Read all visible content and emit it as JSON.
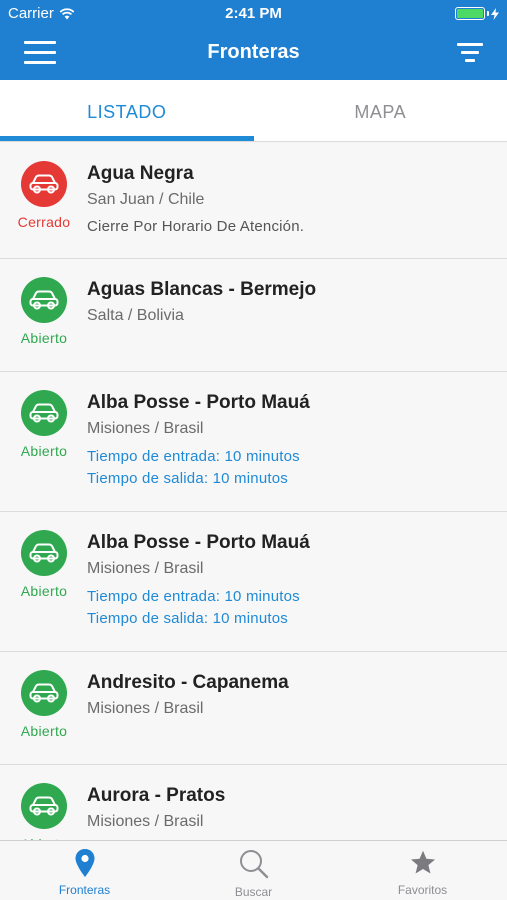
{
  "statusbar": {
    "carrier": "Carrier",
    "time": "2:41 PM"
  },
  "header": {
    "title": "Fronteras"
  },
  "tabs": [
    {
      "label": "LISTADO",
      "active": true
    },
    {
      "label": "MAPA",
      "active": false
    }
  ],
  "colors": {
    "primary": "#1f7fd1",
    "open": "#2fa84f",
    "closed": "#e53935",
    "link": "#1f8ad6"
  },
  "crossings": [
    {
      "name": "Agua Negra",
      "location": "San Juan / Chile",
      "status": "Cerrado",
      "state": "closed",
      "detail": "Cierre Por Horario De Atención."
    },
    {
      "name": "Aguas Blancas - Bermejo",
      "location": "Salta / Bolivia",
      "status": "Abierto",
      "state": "open"
    },
    {
      "name": "Alba Posse - Porto Mauá",
      "location": "Misiones / Brasil",
      "status": "Abierto",
      "state": "open",
      "entry": "Tiempo de entrada: 10 minutos",
      "exit": "Tiempo de salida: 10 minutos"
    },
    {
      "name": "Alba Posse - Porto Mauá",
      "location": "Misiones / Brasil",
      "status": "Abierto",
      "state": "open",
      "entry": "Tiempo de entrada: 10 minutos",
      "exit": "Tiempo de salida: 10 minutos"
    },
    {
      "name": "Andresito - Capanema",
      "location": "Misiones / Brasil",
      "status": "Abierto",
      "state": "open"
    },
    {
      "name": "Aurora - Pratos",
      "location": "Misiones / Brasil",
      "status": "Abierto",
      "state": "open"
    }
  ],
  "bottom_tabs": [
    {
      "label": "Fronteras",
      "icon": "map-pin-icon",
      "active": true
    },
    {
      "label": "Buscar",
      "icon": "search-icon",
      "active": false
    },
    {
      "label": "Favoritos",
      "icon": "star-icon",
      "active": false
    }
  ]
}
